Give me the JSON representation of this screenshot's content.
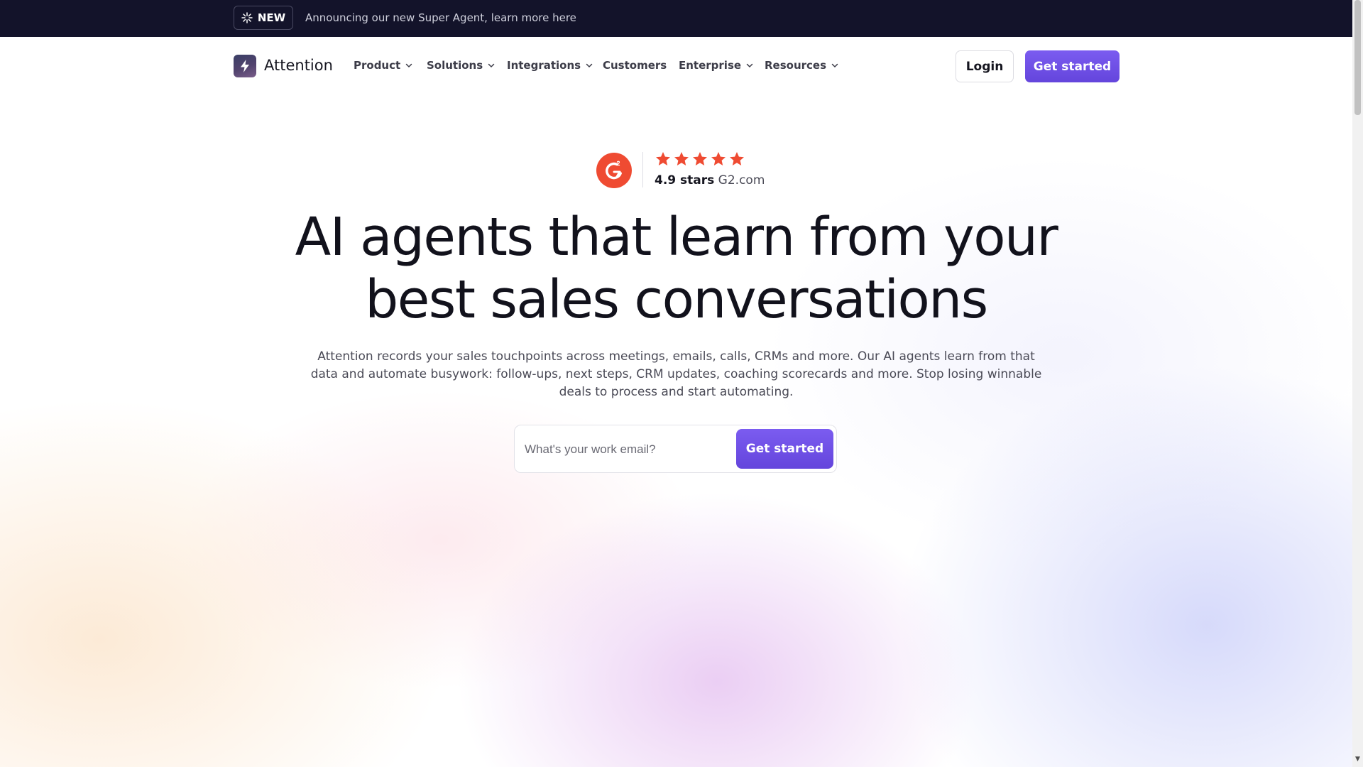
{
  "announcement": {
    "badge_label": "NEW",
    "badge_icon": "sparkle-icon",
    "text": "Announcing our new Super Agent, learn more here"
  },
  "nav": {
    "brand": "Attention",
    "items": [
      {
        "label": "Product",
        "has_dropdown": true
      },
      {
        "label": "Solutions",
        "has_dropdown": true
      },
      {
        "label": "Integrations",
        "has_dropdown": true
      },
      {
        "label": "Customers",
        "has_dropdown": false
      },
      {
        "label": "Enterprise",
        "has_dropdown": true
      },
      {
        "label": "Resources",
        "has_dropdown": true
      }
    ],
    "login_label": "Login",
    "cta_label": "Get started"
  },
  "rating": {
    "score_text": "4.9 stars",
    "source": "G2.com",
    "stars_count": 5
  },
  "hero": {
    "headline_line1": "AI agents that learn from your",
    "headline_line2": "best sales conversations",
    "subtext": "Attention records your sales touchpoints across meetings, emails, calls, CRMs and more. Our AI agents learn from that data and automate busywork: follow-ups, next steps, CRM updates, coaching scorecards and more. Stop losing winnable deals to process and start automating."
  },
  "email_form": {
    "placeholder": "What's your work email?",
    "value": "",
    "submit_label": "Get started"
  },
  "colors": {
    "accent": "#6a4ce4",
    "announce_bg": "#13132a",
    "star": "#ef4b32",
    "g2_red": "#ef4b32"
  }
}
